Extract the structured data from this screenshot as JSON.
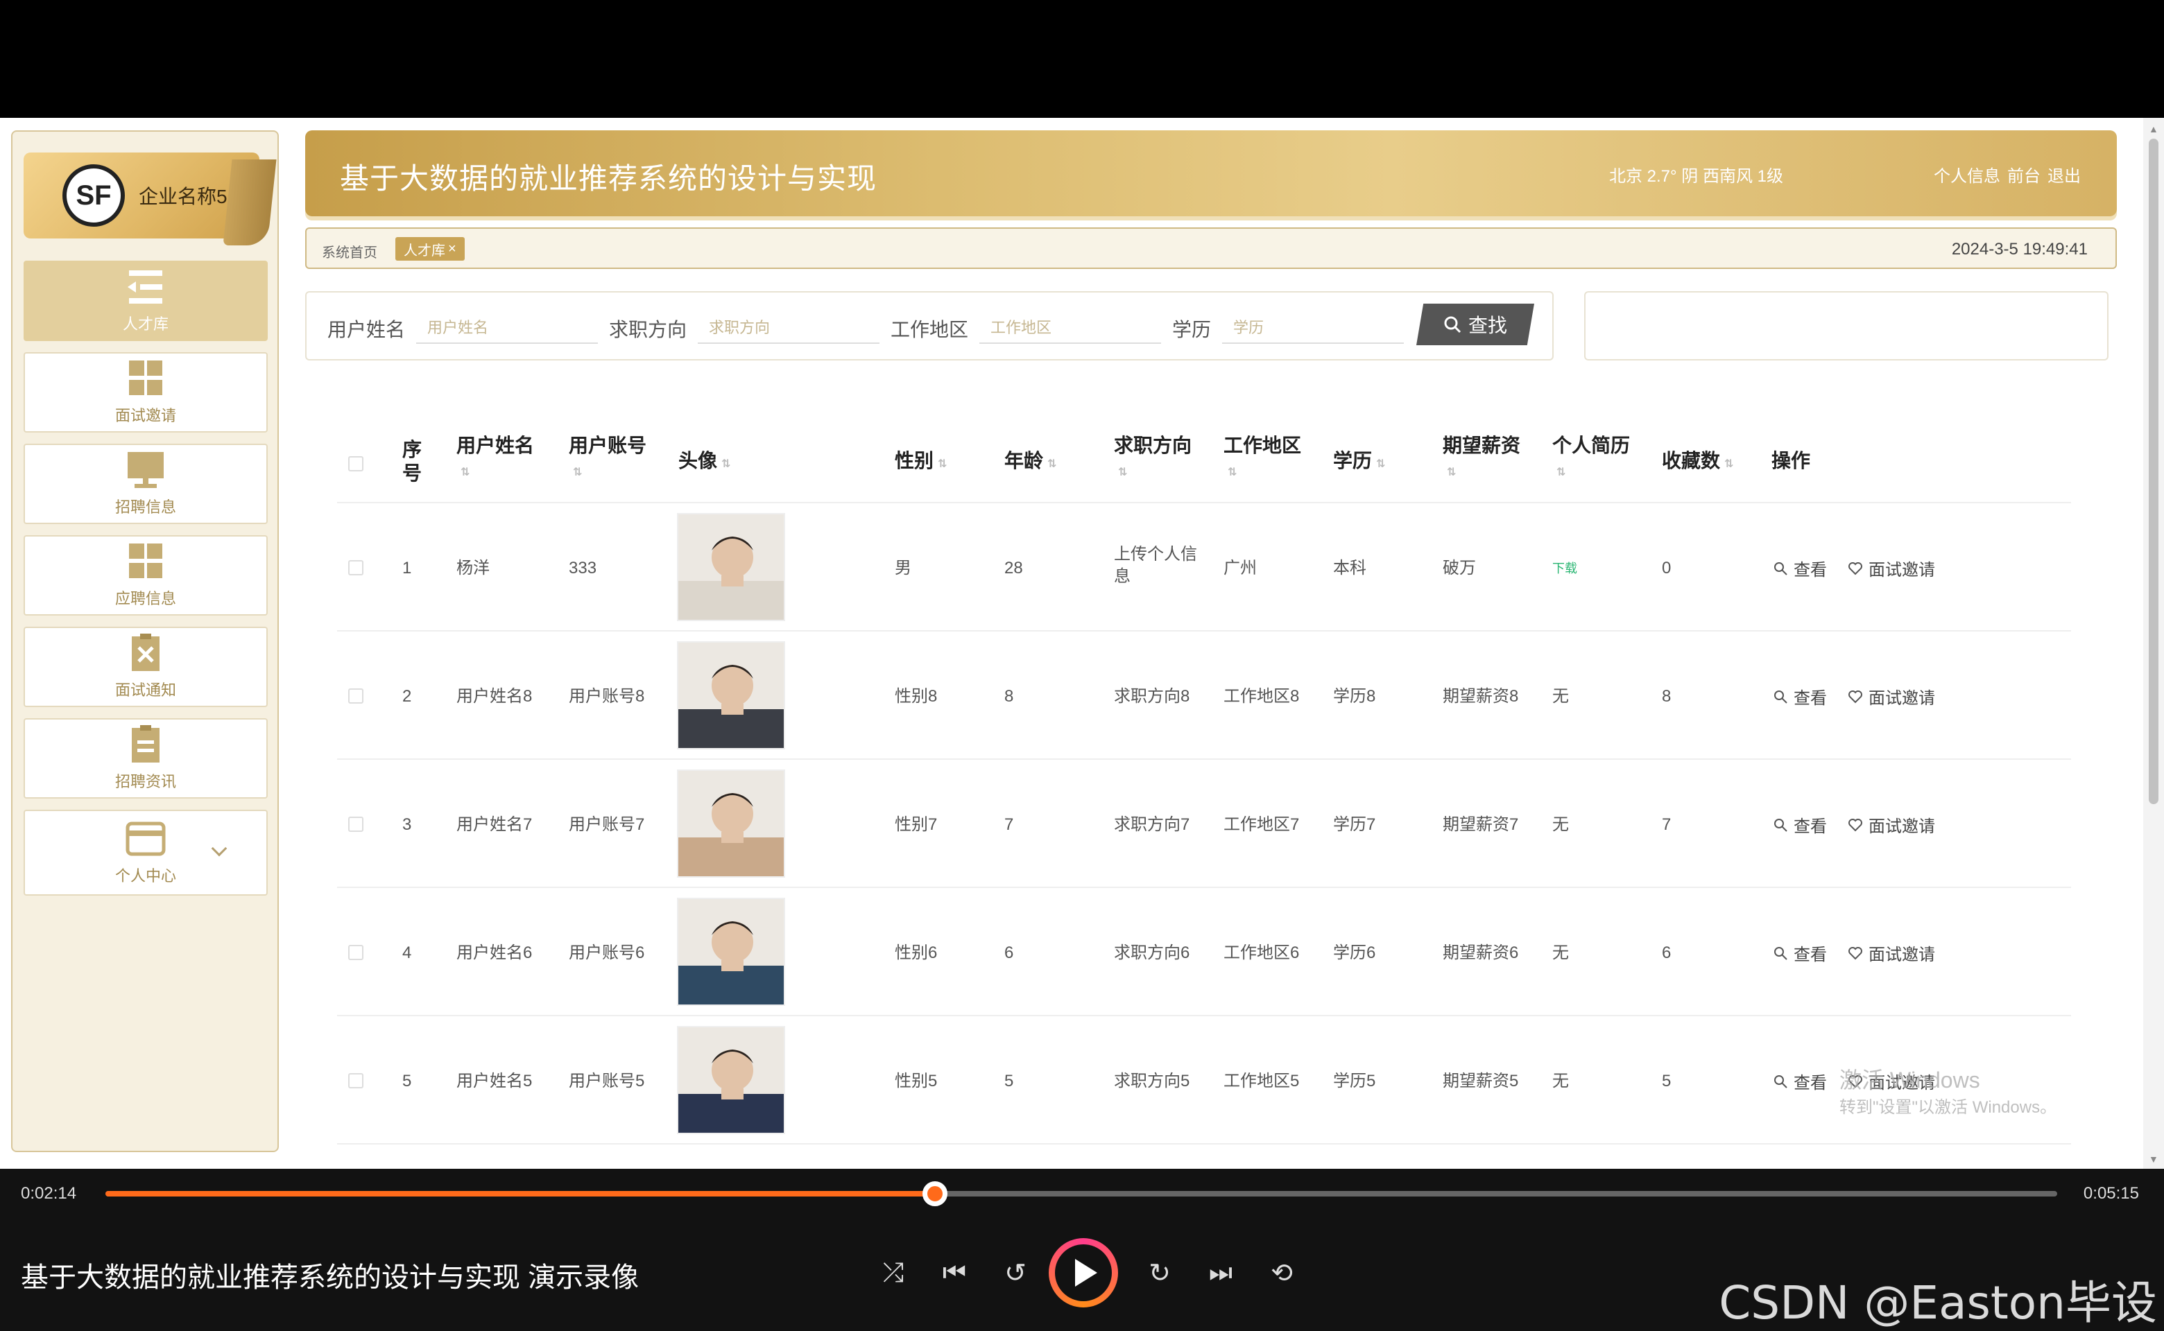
{
  "sidebar": {
    "brand_logo": "SF",
    "brand_name": "企业名称5",
    "items": [
      {
        "label": "人才库",
        "icon": "menu-lines-icon",
        "active": true
      },
      {
        "label": "面试邀请",
        "icon": "grid-icon"
      },
      {
        "label": "招聘信息",
        "icon": "monitor-icon"
      },
      {
        "label": "应聘信息",
        "icon": "grid-icon"
      },
      {
        "label": "面试通知",
        "icon": "clipboard-x-icon"
      },
      {
        "label": "招聘资讯",
        "icon": "clipboard-list-icon"
      },
      {
        "label": "个人中心",
        "icon": "wallet-icon"
      }
    ]
  },
  "header": {
    "title": "基于大数据的就业推荐系统的设计与实现",
    "weather": "北京 2.7° 阴 西南风 1级",
    "links": [
      "个人信息",
      "前台",
      "退出"
    ]
  },
  "breadcrumb": {
    "home": "系统首页",
    "tab": "人才库",
    "tab_close": "×",
    "datetime": "2024-3-5 19:49:41"
  },
  "search": {
    "fields": [
      {
        "label": "用户姓名",
        "placeholder": "用户姓名"
      },
      {
        "label": "求职方向",
        "placeholder": "求职方向"
      },
      {
        "label": "工作地区",
        "placeholder": "工作地区"
      },
      {
        "label": "学历",
        "placeholder": "学历"
      }
    ],
    "button": "查找"
  },
  "table": {
    "headers": [
      "序号",
      "用户姓名",
      "用户账号",
      "头像",
      "性别",
      "年龄",
      "求职方向",
      "工作地区",
      "学历",
      "期望薪资",
      "个人简历",
      "收藏数",
      "操作"
    ],
    "rows": [
      {
        "no": "1",
        "name": "杨洋",
        "account": "333",
        "gender": "男",
        "age": "28",
        "direction": "上传个人信息",
        "area": "广州",
        "edu": "本科",
        "salary": "破万",
        "resume": "下载",
        "fav": "0",
        "avatar": "#dcd6cc"
      },
      {
        "no": "2",
        "name": "用户姓名8",
        "account": "用户账号8",
        "gender": "性别8",
        "age": "8",
        "direction": "求职方向8",
        "area": "工作地区8",
        "edu": "学历8",
        "salary": "期望薪资8",
        "resume": "无",
        "fav": "8",
        "avatar": "#3b3e46"
      },
      {
        "no": "3",
        "name": "用户姓名7",
        "account": "用户账号7",
        "gender": "性别7",
        "age": "7",
        "direction": "求职方向7",
        "area": "工作地区7",
        "edu": "学历7",
        "salary": "期望薪资7",
        "resume": "无",
        "fav": "7",
        "avatar": "#c9a98a"
      },
      {
        "no": "4",
        "name": "用户姓名6",
        "account": "用户账号6",
        "gender": "性别6",
        "age": "6",
        "direction": "求职方向6",
        "area": "工作地区6",
        "edu": "学历6",
        "salary": "期望薪资6",
        "resume": "无",
        "fav": "6",
        "avatar": "#2f4a63"
      },
      {
        "no": "5",
        "name": "用户姓名5",
        "account": "用户账号5",
        "gender": "性别5",
        "age": "5",
        "direction": "求职方向5",
        "area": "工作地区5",
        "edu": "学历5",
        "salary": "期望薪资5",
        "resume": "无",
        "fav": "5",
        "avatar": "#2a3550"
      }
    ],
    "op_view": "查看",
    "op_invite": "面试邀请"
  },
  "watermark": {
    "line1": "激活 Windows",
    "line2": "转到\"设置\"以激活 Windows。"
  },
  "player": {
    "current": "0:02:14",
    "total": "0:05:15",
    "progress": 0.425,
    "title": "基于大数据的就业推荐系统的设计与实现 演示录像",
    "brand": "CSDN @Easton毕设",
    "accent": "#ff6a1a"
  }
}
